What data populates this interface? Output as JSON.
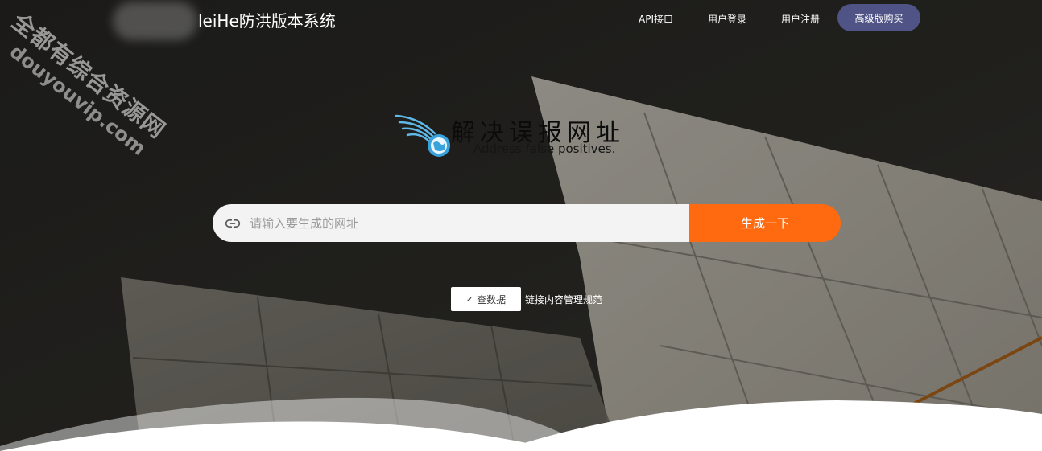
{
  "watermark": {
    "line1": "全都有综合资源网",
    "line2": "douyouvip.com"
  },
  "header": {
    "title": "leiHe防洪版本系统",
    "nav": {
      "api": "API接口",
      "login": "用户登录",
      "register": "用户注册",
      "buy": "高级版购买"
    }
  },
  "brand": {
    "zh": "解决误报网址",
    "en": "Address false positives.",
    "icon": "winged-globe-icon"
  },
  "search": {
    "placeholder": "请输入要生成的网址",
    "value": "",
    "icon": "link-icon",
    "button": "生成一下"
  },
  "actions": {
    "check_label": "查数据",
    "check_icon": "✓",
    "policy_link": "链接内容管理规范"
  },
  "colors": {
    "accent": "#ff6a10",
    "buy_button": "#4f5385",
    "background": "#2a2a27"
  }
}
